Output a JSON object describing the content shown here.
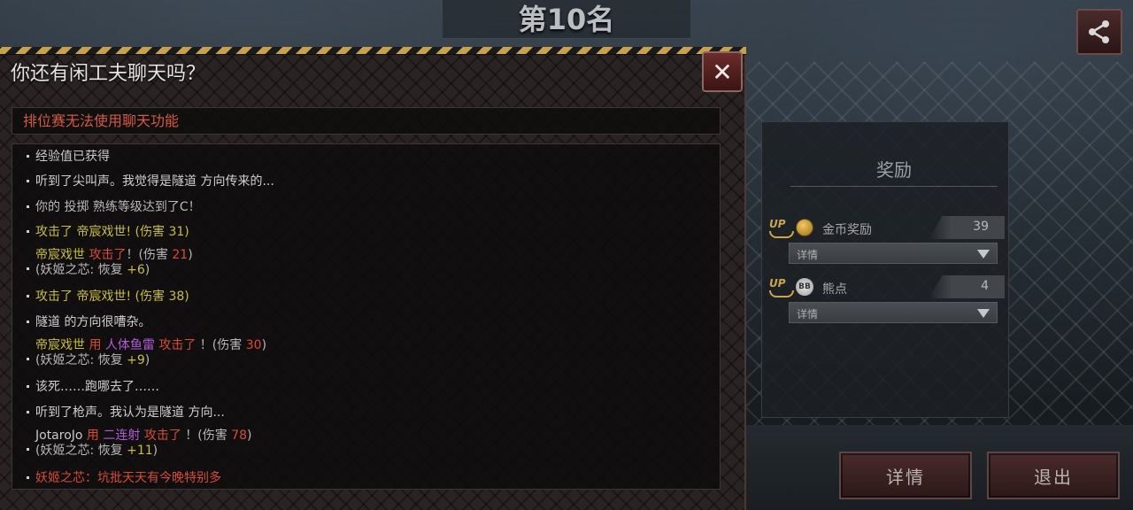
{
  "header": {
    "rank_title": "第10名"
  },
  "share_icon": "share-icon",
  "chat_modal": {
    "title": "你还有闲工夫聊天吗？",
    "close_icon": "close-icon",
    "notice": "排位赛无法使用聊天功能",
    "lines": [
      {
        "segments": [
          {
            "text": "经验值已获得",
            "color": "#c9c9c9"
          }
        ]
      },
      {
        "segments": [
          {
            "text": "听到了尖叫声。我觉得是隧道 方向传来的...",
            "color": "#cfcfcf"
          }
        ]
      },
      {
        "segments": [
          {
            "text": "你的 投掷 熟练等级达到了C！",
            "color": "#b8b8b8"
          }
        ]
      },
      {
        "segments": [
          {
            "text": "攻击了 帝宸戏世! (伤害 ",
            "color": "#c9be3a"
          },
          {
            "text": "31",
            "color": "#c9be3a"
          },
          {
            "text": ")",
            "color": "#c9be3a"
          }
        ]
      },
      {
        "segments": [
          {
            "text": "帝宸戏世",
            "color": "#c9be3a"
          },
          {
            "text": "  攻击了",
            "color": "#d84b36"
          },
          {
            "text": "！(伤害 ",
            "color": "#b8b8b8"
          },
          {
            "text": "21",
            "color": "#d84b36"
          },
          {
            "text": ")",
            "color": "#b8b8b8"
          }
        ],
        "second": [
          {
            "text": "(妖姬之芯: 恢复 ",
            "color": "#b8b8b8"
          },
          {
            "text": "+6",
            "color": "#c9be3a"
          },
          {
            "text": ")",
            "color": "#b8b8b8"
          }
        ]
      },
      {
        "segments": [
          {
            "text": "攻击了 帝宸戏世! (伤害 ",
            "color": "#c9be3a"
          },
          {
            "text": "38",
            "color": "#c9be3a"
          },
          {
            "text": ")",
            "color": "#c9be3a"
          }
        ]
      },
      {
        "segments": [
          {
            "text": "隧道 的方向很嘈杂。",
            "color": "#cfcfcf"
          }
        ]
      },
      {
        "segments": [
          {
            "text": "帝宸戏世",
            "color": "#c9be3a"
          },
          {
            "text": "  用 ",
            "color": "#d84b36"
          },
          {
            "text": "人体鱼雷",
            "color": "#b35bd8"
          },
          {
            "text": " 攻击了",
            "color": "#d84b36"
          },
          {
            "text": " ！(伤害 ",
            "color": "#b8b8b8"
          },
          {
            "text": "30",
            "color": "#d84b36"
          },
          {
            "text": ")",
            "color": "#b8b8b8"
          }
        ],
        "second": [
          {
            "text": "(妖姬之芯: 恢复 ",
            "color": "#b8b8b8"
          },
          {
            "text": "+9",
            "color": "#c9be3a"
          },
          {
            "text": ")",
            "color": "#b8b8b8"
          }
        ]
      },
      {
        "segments": [
          {
            "text": "该死……跑哪去了……",
            "color": "#cfcfcf"
          }
        ]
      },
      {
        "segments": [
          {
            "text": "听到了枪声。我认为是隧道 方向...",
            "color": "#cfcfcf"
          }
        ]
      },
      {
        "segments": [
          {
            "text": "JotaroJo",
            "color": "#c9c9c9"
          },
          {
            "text": "  用 ",
            "color": "#d84b36"
          },
          {
            "text": "二连射",
            "color": "#b35bd8"
          },
          {
            "text": " 攻击了",
            "color": "#d84b36"
          },
          {
            "text": " ！(伤害 ",
            "color": "#b8b8b8"
          },
          {
            "text": "78",
            "color": "#d84b36"
          },
          {
            "text": ")",
            "color": "#b8b8b8"
          }
        ],
        "second": [
          {
            "text": "(妖姬之芯: 恢复 ",
            "color": "#b8b8b8"
          },
          {
            "text": "+11",
            "color": "#c9be3a"
          },
          {
            "text": ")",
            "color": "#b8b8b8"
          }
        ]
      },
      {
        "segments": [
          {
            "text": "妖姬之芯：坑批天天有今晚特别多",
            "color": "#d84b36"
          }
        ]
      }
    ]
  },
  "reward_panel": {
    "title": "奖励",
    "items": [
      {
        "up_label": "UP",
        "icon": "coin-icon",
        "name": "金币奖励",
        "value": "39",
        "detail_label": "详情"
      },
      {
        "up_label": "UP",
        "icon": "bear-point-icon",
        "icon_text": "BB",
        "name": "熊点",
        "value": "4",
        "detail_label": "详情"
      }
    ]
  },
  "buttons": {
    "details": "详情",
    "exit": "退出"
  }
}
